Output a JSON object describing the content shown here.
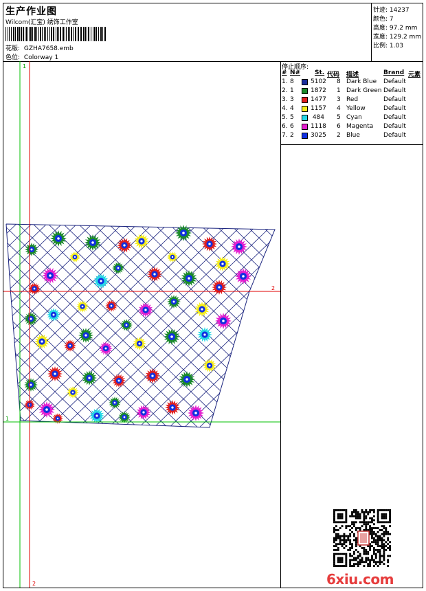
{
  "header": {
    "title": "生产作业图",
    "company": "Wilcom(汇宝) 绣饰工作室",
    "design_label": "花版:",
    "design_value": "GZHA7658.emb",
    "colorway_label": "色位:",
    "colorway_value": "Colorway 1"
  },
  "stats": [
    {
      "label": "针迹:",
      "value": "14237"
    },
    {
      "label": "颜色:",
      "value": "7"
    },
    {
      "label": "高度:",
      "value": "97.2 mm"
    },
    {
      "label": "宽度:",
      "value": "129.2 mm"
    },
    {
      "label": "比例:",
      "value": "1.03"
    }
  ],
  "design": {
    "guides": {
      "v1_label": "1",
      "v2_label": "2",
      "h1_label": "1",
      "h2_label": "2"
    }
  },
  "stop_sequence": {
    "title": "停止顺序:",
    "columns": [
      "#",
      "N#",
      "St.",
      "代码",
      "描述",
      "Brand",
      "元素"
    ],
    "rows": [
      {
        "seq": "1.",
        "n": "8",
        "color": "#1a2e9c",
        "stitches": "5102",
        "code": "8",
        "desc": "Dark Blue",
        "brand": "Default"
      },
      {
        "seq": "2.",
        "n": "1",
        "color": "#1a8a2a",
        "stitches": "1872",
        "code": "1",
        "desc": "Dark Green",
        "brand": "Default"
      },
      {
        "seq": "3.",
        "n": "3",
        "color": "#e01f1f",
        "stitches": "1477",
        "code": "3",
        "desc": "Red",
        "brand": "Default"
      },
      {
        "seq": "4.",
        "n": "4",
        "color": "#f5ee1a",
        "stitches": "1157",
        "code": "4",
        "desc": "Yellow",
        "brand": "Default"
      },
      {
        "seq": "5.",
        "n": "5",
        "color": "#24d8e6",
        "stitches": "484",
        "code": "5",
        "desc": "Cyan",
        "brand": "Default"
      },
      {
        "seq": "6.",
        "n": "6",
        "color": "#e41fd0",
        "stitches": "1118",
        "code": "6",
        "desc": "Magenta",
        "brand": "Default"
      },
      {
        "seq": "7.",
        "n": "2",
        "color": "#1030e0",
        "stitches": "3025",
        "code": "2",
        "desc": "Blue",
        "brand": "Default"
      }
    ]
  },
  "watermark": {
    "logo_text": "6xiu.com"
  }
}
